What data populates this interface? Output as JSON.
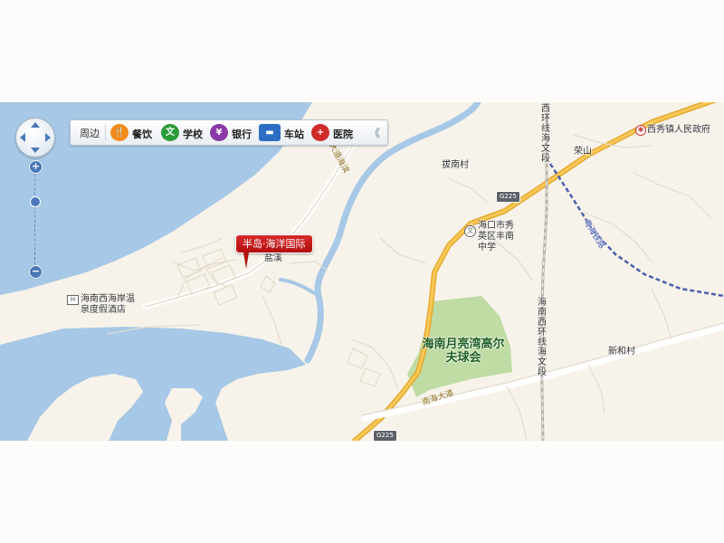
{
  "colors": {
    "water": "#a7c8e6",
    "land": "#f7f3ea",
    "highway": "#f2b43a",
    "main_road": "#ffffff",
    "river": "#a7c8e6",
    "golf_course": "#bfdca4",
    "railway": "#4a5fae",
    "marker": "#c81e1e"
  },
  "toolbar": {
    "title": "周边",
    "items": [
      {
        "label": "餐饮",
        "icon": "fork-knife-icon",
        "color": "#f28a1a",
        "glyph": "🍴"
      },
      {
        "label": "学校",
        "icon": "school-icon",
        "color": "#2c9b3a",
        "glyph": "文"
      },
      {
        "label": "银行",
        "icon": "bank-icon",
        "color": "#8a3aa8",
        "glyph": "¥"
      },
      {
        "label": "车站",
        "icon": "bus-icon",
        "color": "#2a6fc4",
        "glyph": "▬"
      },
      {
        "label": "医院",
        "icon": "hospital-icon",
        "color": "#d12a2a",
        "glyph": "+"
      }
    ],
    "collapse_glyph": "《"
  },
  "zoom": {
    "in_glyph": "+",
    "out_glyph": "−",
    "level_fraction": 0.3
  },
  "marker": {
    "label": "半岛·海洋国际"
  },
  "labels": {
    "hotel": "海南西海岸温泉度假酒店",
    "yanxi": "盐溪",
    "banan_cun": "拔南村",
    "school": "海口市秀英区丰南中学",
    "golf": "海南月亮湾高尔夫球会",
    "xiuying_gov": "西秀镇人民政府",
    "rongshan": "荣山",
    "xinhe_cun": "新和村",
    "nanhai_road": "南海大道",
    "west_ring_line_1": "西环线海文段",
    "west_ring_line_2": "海南西环线海文段",
    "yinghai_road": "大道海滨",
    "railway": "粤海铁路",
    "g225_a": "G225",
    "g225_b": "G225"
  }
}
